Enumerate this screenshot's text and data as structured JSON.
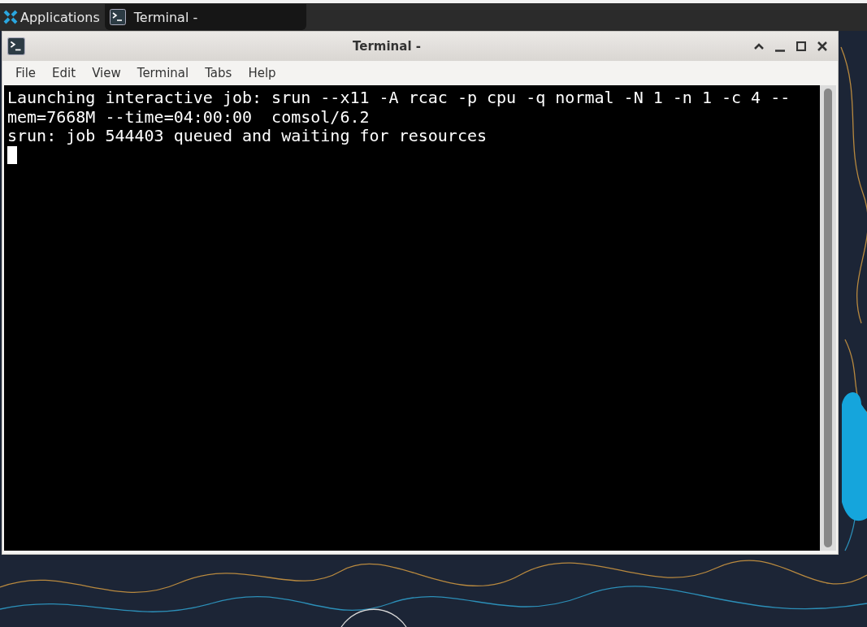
{
  "taskbar": {
    "menu_label": "Applications",
    "task": {
      "title": "Terminal -"
    }
  },
  "window": {
    "title": "Terminal -",
    "menu": [
      "File",
      "Edit",
      "View",
      "Terminal",
      "Tabs",
      "Help"
    ],
    "terminal_lines": [
      "Launching interactive job: srun --x11 -A rcac -p cpu -q normal -N 1 -n 1 -c 4 --",
      "mem=7668M --time=04:00:00  comsol/6.2",
      "srun: job 544403 queued and waiting for resources"
    ]
  }
}
